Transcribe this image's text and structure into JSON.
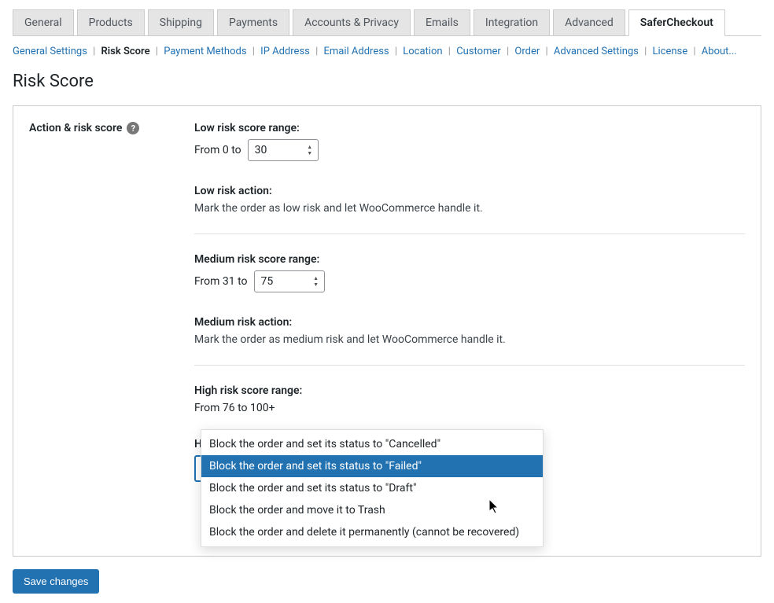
{
  "tabs": {
    "items": [
      "General",
      "Products",
      "Shipping",
      "Payments",
      "Accounts & Privacy",
      "Emails",
      "Integration",
      "Advanced",
      "SaferCheckout"
    ],
    "active": "SaferCheckout"
  },
  "subnav": {
    "items": [
      "General Settings",
      "Risk Score",
      "Payment Methods",
      "IP Address",
      "Email Address",
      "Location",
      "Customer",
      "Order",
      "Advanced Settings",
      "License",
      "About..."
    ],
    "current": "Risk Score"
  },
  "page_title": "Risk Score",
  "field_label": "Action & risk score",
  "help_tooltip": "?",
  "low": {
    "range_label": "Low risk score range:",
    "from_text": "From 0 to",
    "value": "30",
    "action_label": "Low risk action:",
    "action_desc": "Mark the order as low risk and let WooCommerce handle it."
  },
  "medium": {
    "range_label": "Medium risk score range:",
    "from_text": "From 31 to",
    "value": "75",
    "action_label": "Medium risk action:",
    "action_desc": "Mark the order as medium risk and let WooCommerce handle it."
  },
  "high": {
    "range_label": "High risk score range:",
    "range_text": "From 76 to 100+",
    "action_label": "High risk action:",
    "selected": "Block the order and set its status to \"Failed\"",
    "options": [
      "Block the order and set its status to \"Cancelled\"",
      "Block the order and set its status to \"Failed\"",
      "Block the order and set its status to \"Draft\"",
      "Block the order and move it to Trash",
      "Block the order and delete it permanently (cannot be recovered)"
    ]
  },
  "save_label": "Save changes"
}
